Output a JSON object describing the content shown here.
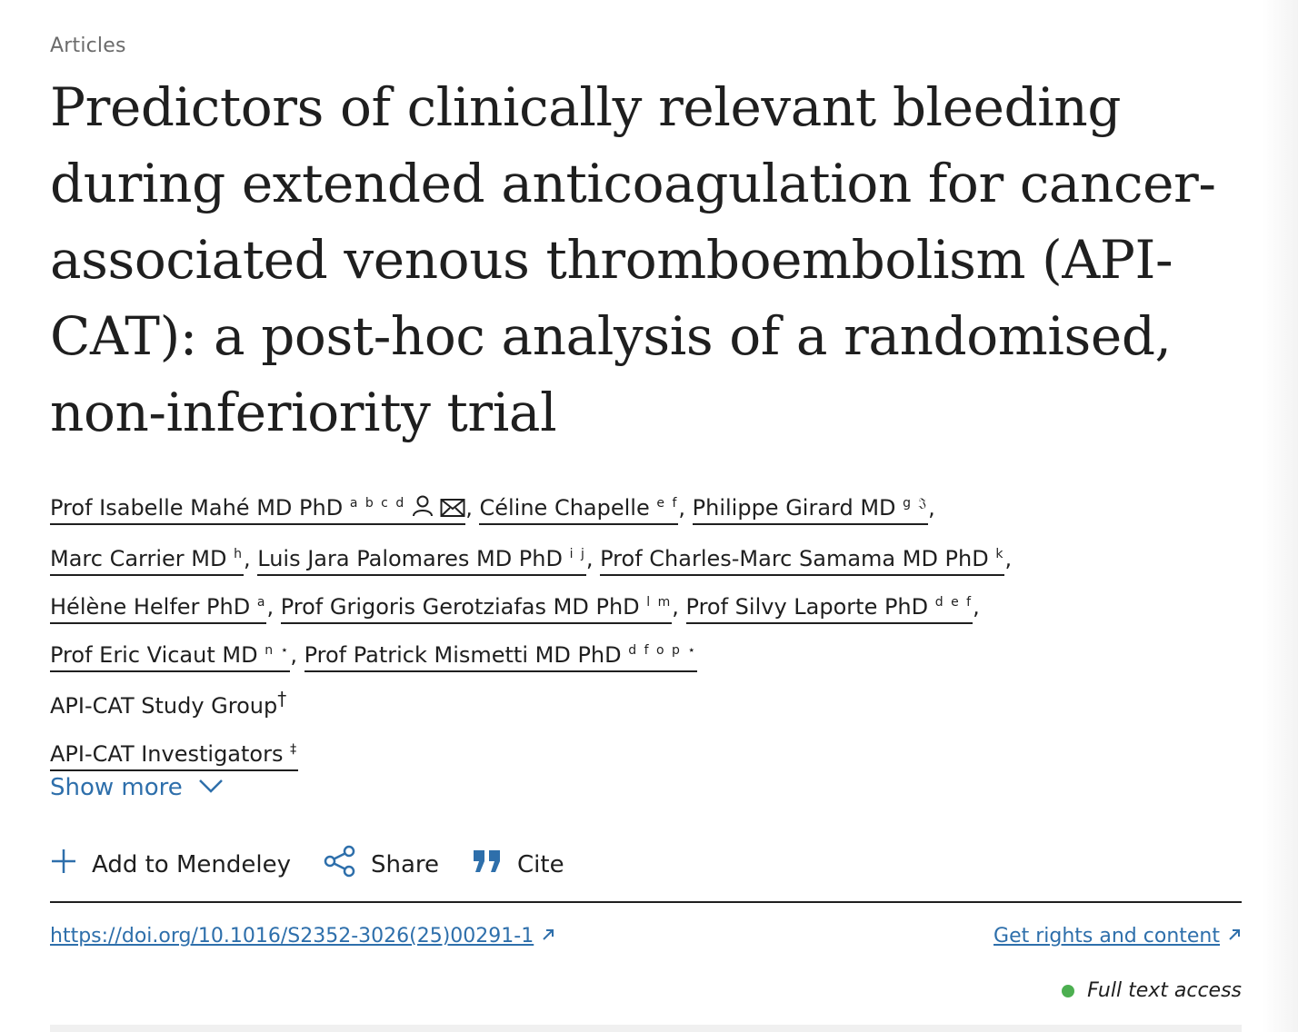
{
  "section_label": "Articles",
  "title": "Predictors of clinically relevant bleeding during extended anticoagulation for cancer-associated venous thromboembolism (API-CAT): a post-hoc analysis of a randomised, non-inferiority trial",
  "authors": [
    {
      "name": "Prof Isabelle Mahé MD PhD",
      "sup": "a b c d"
    },
    {
      "name": "Céline Chapelle",
      "sup": "e f"
    },
    {
      "name": "Philippe Girard MD",
      "sup": "g 𝔍"
    },
    {
      "name": "Marc Carrier MD",
      "sup": "h"
    },
    {
      "name": "Luis Jara Palomares MD PhD",
      "sup": "i j"
    },
    {
      "name": "Prof Charles-Marc Samama MD PhD",
      "sup": "k"
    },
    {
      "name": "Hélène Helfer PhD",
      "sup": "a"
    },
    {
      "name": "Prof Grigoris Gerotziafas MD PhD",
      "sup": "l m"
    },
    {
      "name": "Prof Silvy Laporte PhD",
      "sup": "d e f"
    },
    {
      "name": "Prof Eric Vicaut MD",
      "sup": "n ⋆"
    },
    {
      "name": "Prof Patrick Mismetti MD PhD",
      "sup": "d f o p ⋆"
    }
  ],
  "groups": [
    {
      "name": "API-CAT Study Group",
      "sup": "†"
    },
    {
      "name": "API-CAT Investigators",
      "sup": "‡"
    }
  ],
  "show_more": "Show more",
  "actions": {
    "mendeley": "Add to Mendeley",
    "share": "Share",
    "cite": "Cite"
  },
  "doi": "https://doi.org/10.1016/S2352-3026(25)00291-1",
  "rights": "Get rights and content",
  "access": "Full text access",
  "colors": {
    "link": "#2e6fab",
    "access_dot": "#4caf50"
  }
}
